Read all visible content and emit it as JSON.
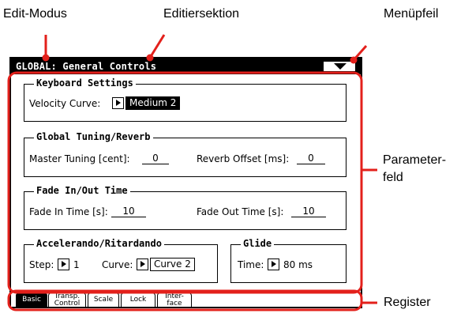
{
  "annotations": {
    "edit_mode": "Edit-Modus",
    "edit_section": "Editiersektion",
    "menu_arrow": "Menüpfeil",
    "parameter_field_line1": "Parameter-",
    "parameter_field_line2": "feld",
    "register": "Register"
  },
  "colors": {
    "annotation": "#e3201b",
    "display": "#000000"
  },
  "titlebar": {
    "title": "GLOBAL: General Controls",
    "menu_icon": "triangle-down"
  },
  "groups": {
    "keyboard": {
      "title": "Keyboard Settings",
      "velocity_curve_label": "Velocity Curve:",
      "velocity_curve_value": "Medium 2"
    },
    "tuning": {
      "title": "Global Tuning/Reverb",
      "master_tuning_label": "Master Tuning [cent]:",
      "master_tuning_value": "0",
      "reverb_offset_label": "Reverb Offset [ms]:",
      "reverb_offset_value": "0"
    },
    "fade": {
      "title": "Fade In/Out Time",
      "fade_in_label": "Fade In Time [s]:",
      "fade_in_value": "10",
      "fade_out_label": "Fade Out Time [s]:",
      "fade_out_value": "10"
    },
    "accel": {
      "title": "Accelerando/Ritardando",
      "step_label": "Step:",
      "step_value": "1",
      "curve_label": "Curve:",
      "curve_value": "Curve 2"
    },
    "glide": {
      "title": "Glide",
      "time_label": "Time:",
      "time_value": "80 ms"
    }
  },
  "tabs": [
    {
      "label": "Basic",
      "active": true
    },
    {
      "label": "Transp.\nControl",
      "active": false
    },
    {
      "label": "Scale",
      "active": false
    },
    {
      "label": "Lock",
      "active": false
    },
    {
      "label": "Inter-\nface",
      "active": false
    }
  ]
}
